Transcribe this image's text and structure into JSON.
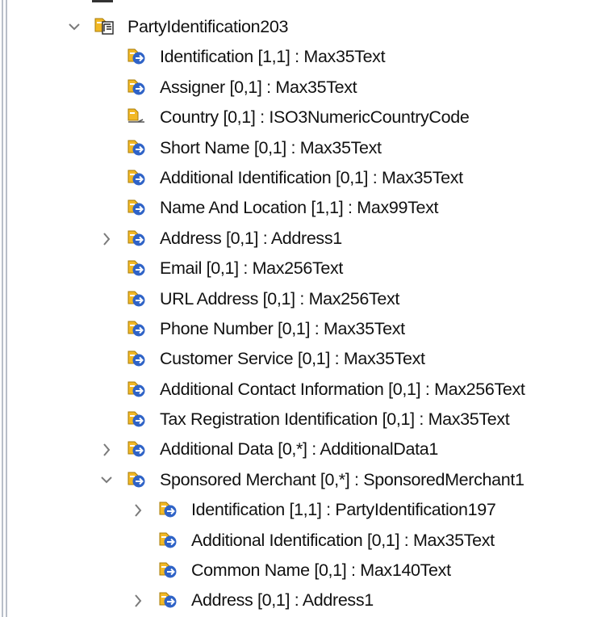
{
  "tree": {
    "root": {
      "label": "PartyIdentification203",
      "expanded": true,
      "icon": "message-component-icon"
    },
    "items": [
      {
        "label": "Identification [1,1] : Max35Text",
        "level": 1,
        "expandable": false,
        "icon": "element-icon"
      },
      {
        "label": "Assigner [0,1] : Max35Text",
        "level": 1,
        "expandable": false,
        "icon": "element-icon"
      },
      {
        "label": "Country [0,1] : ISO3NumericCountryCode",
        "level": 1,
        "expandable": false,
        "icon": "code-element-icon"
      },
      {
        "label": "Short Name [0,1] : Max35Text",
        "level": 1,
        "expandable": false,
        "icon": "element-icon"
      },
      {
        "label": "Additional Identification [0,1] : Max35Text",
        "level": 1,
        "expandable": false,
        "icon": "element-icon"
      },
      {
        "label": "Name And Location [1,1] : Max99Text",
        "level": 1,
        "expandable": false,
        "icon": "element-icon"
      },
      {
        "label": "Address [0,1] : Address1",
        "level": 1,
        "expandable": true,
        "expanded": false,
        "icon": "element-icon"
      },
      {
        "label": "Email [0,1] : Max256Text",
        "level": 1,
        "expandable": false,
        "icon": "element-icon"
      },
      {
        "label": "URL Address [0,1] : Max256Text",
        "level": 1,
        "expandable": false,
        "icon": "element-icon"
      },
      {
        "label": "Phone Number [0,1] : Max35Text",
        "level": 1,
        "expandable": false,
        "icon": "element-icon"
      },
      {
        "label": "Customer Service [0,1] : Max35Text",
        "level": 1,
        "expandable": false,
        "icon": "element-icon"
      },
      {
        "label": "Additional Contact Information [0,1] : Max256Text",
        "level": 1,
        "expandable": false,
        "icon": "element-icon"
      },
      {
        "label": "Tax Registration Identification [0,1] : Max35Text",
        "level": 1,
        "expandable": false,
        "icon": "element-icon"
      },
      {
        "label": "Additional Data [0,*] : AdditionalData1",
        "level": 1,
        "expandable": true,
        "expanded": false,
        "icon": "element-icon"
      },
      {
        "label": "Sponsored Merchant [0,*] : SponsoredMerchant1",
        "level": 1,
        "expandable": true,
        "expanded": true,
        "icon": "element-icon"
      },
      {
        "label": "Identification [1,1] : PartyIdentification197",
        "level": 2,
        "expandable": true,
        "expanded": false,
        "icon": "element-icon"
      },
      {
        "label": "Additional Identification [0,1] : Max35Text",
        "level": 2,
        "expandable": false,
        "icon": "element-icon"
      },
      {
        "label": "Common Name [0,1] : Max140Text",
        "level": 2,
        "expandable": false,
        "icon": "element-icon"
      },
      {
        "label": "Address [0,1] : Address1",
        "level": 2,
        "expandable": true,
        "expanded": false,
        "icon": "element-icon"
      }
    ]
  },
  "colors": {
    "element_icon_yellow": "#f2b824",
    "element_icon_blue": "#2f63c7",
    "twisty": "#7a7a7a",
    "edge_line": "#b8bec8"
  }
}
